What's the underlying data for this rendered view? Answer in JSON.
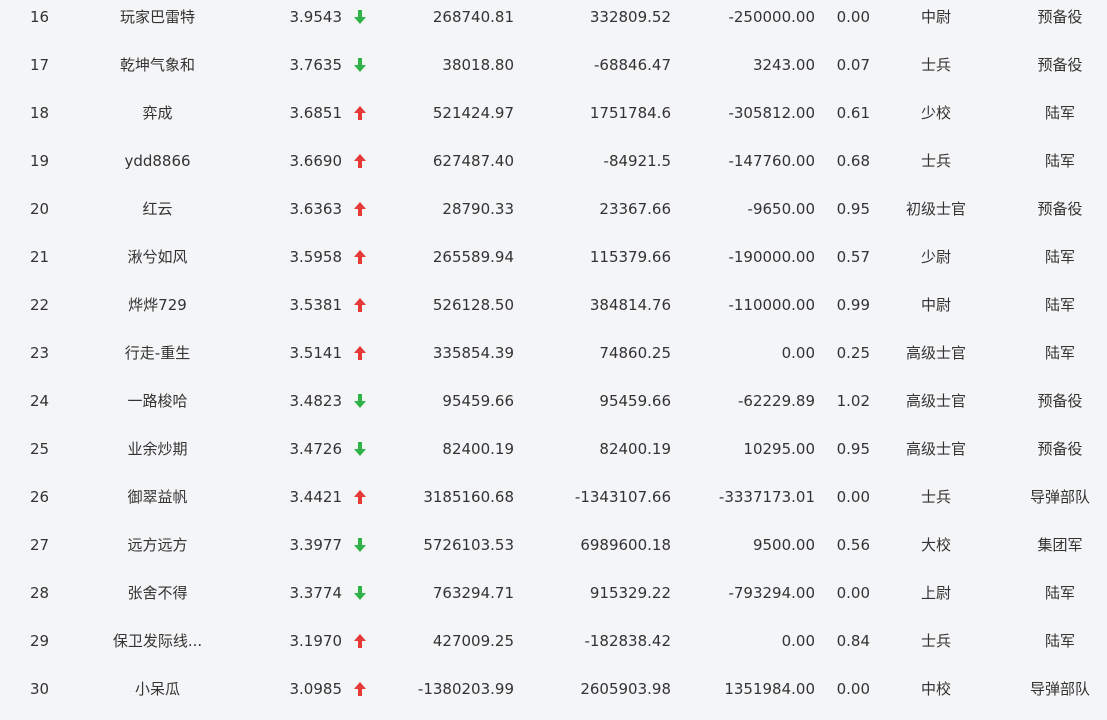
{
  "rows": [
    {
      "rank": "16",
      "name": "玩家巴雷特",
      "score": "3.9543",
      "trend": "down",
      "v1": "268740.81",
      "v2": "332809.52",
      "v3": "-250000.00",
      "ratio": "0.00",
      "title": "中尉",
      "unit": "预备役"
    },
    {
      "rank": "17",
      "name": "乾坤气象和",
      "score": "3.7635",
      "trend": "down",
      "v1": "38018.80",
      "v2": "-68846.47",
      "v3": "3243.00",
      "ratio": "0.07",
      "title": "士兵",
      "unit": "预备役"
    },
    {
      "rank": "18",
      "name": "弈成",
      "score": "3.6851",
      "trend": "up",
      "v1": "521424.97",
      "v2": "1751784.6",
      "v3": "-305812.00",
      "ratio": "0.61",
      "title": "少校",
      "unit": "陆军"
    },
    {
      "rank": "19",
      "name": "ydd8866",
      "score": "3.6690",
      "trend": "up",
      "v1": "627487.40",
      "v2": "-84921.5",
      "v3": "-147760.00",
      "ratio": "0.68",
      "title": "士兵",
      "unit": "陆军"
    },
    {
      "rank": "20",
      "name": "红云",
      "score": "3.6363",
      "trend": "up",
      "v1": "28790.33",
      "v2": "23367.66",
      "v3": "-9650.00",
      "ratio": "0.95",
      "title": "初级士官",
      "unit": "预备役"
    },
    {
      "rank": "21",
      "name": "湫兮如风",
      "score": "3.5958",
      "trend": "up",
      "v1": "265589.94",
      "v2": "115379.66",
      "v3": "-190000.00",
      "ratio": "0.57",
      "title": "少尉",
      "unit": "陆军"
    },
    {
      "rank": "22",
      "name": "烨烨729",
      "score": "3.5381",
      "trend": "up",
      "v1": "526128.50",
      "v2": "384814.76",
      "v3": "-110000.00",
      "ratio": "0.99",
      "title": "中尉",
      "unit": "陆军"
    },
    {
      "rank": "23",
      "name": "行走-重生",
      "score": "3.5141",
      "trend": "up",
      "v1": "335854.39",
      "v2": "74860.25",
      "v3": "0.00",
      "ratio": "0.25",
      "title": "高级士官",
      "unit": "陆军"
    },
    {
      "rank": "24",
      "name": "一路梭哈",
      "score": "3.4823",
      "trend": "down",
      "v1": "95459.66",
      "v2": "95459.66",
      "v3": "-62229.89",
      "ratio": "1.02",
      "title": "高级士官",
      "unit": "预备役"
    },
    {
      "rank": "25",
      "name": "业余炒期",
      "score": "3.4726",
      "trend": "down",
      "v1": "82400.19",
      "v2": "82400.19",
      "v3": "10295.00",
      "ratio": "0.95",
      "title": "高级士官",
      "unit": "预备役"
    },
    {
      "rank": "26",
      "name": "御翠益帆",
      "score": "3.4421",
      "trend": "up",
      "v1": "3185160.68",
      "v2": "-1343107.66",
      "v3": "-3337173.01",
      "ratio": "0.00",
      "title": "士兵",
      "unit": "导弹部队"
    },
    {
      "rank": "27",
      "name": "远方远方",
      "score": "3.3977",
      "trend": "down",
      "v1": "5726103.53",
      "v2": "6989600.18",
      "v3": "9500.00",
      "ratio": "0.56",
      "title": "大校",
      "unit": "集团军"
    },
    {
      "rank": "28",
      "name": "张舍不得",
      "score": "3.3774",
      "trend": "down",
      "v1": "763294.71",
      "v2": "915329.22",
      "v3": "-793294.00",
      "ratio": "0.00",
      "title": "上尉",
      "unit": "陆军"
    },
    {
      "rank": "29",
      "name": "保卫发际线...",
      "score": "3.1970",
      "trend": "up",
      "v1": "427009.25",
      "v2": "-182838.42",
      "v3": "0.00",
      "ratio": "0.84",
      "title": "士兵",
      "unit": "陆军"
    },
    {
      "rank": "30",
      "name": "小呆瓜",
      "score": "3.0985",
      "trend": "up",
      "v1": "-1380203.99",
      "v2": "2605903.98",
      "v3": "1351984.00",
      "ratio": "0.00",
      "title": "中校",
      "unit": "导弹部队"
    }
  ],
  "colors": {
    "up": "#e53935",
    "down": "#2fb344",
    "text": "#333333",
    "background": "#f4f5f7"
  },
  "icons": {
    "up": "arrow-up-icon",
    "down": "arrow-down-icon"
  }
}
